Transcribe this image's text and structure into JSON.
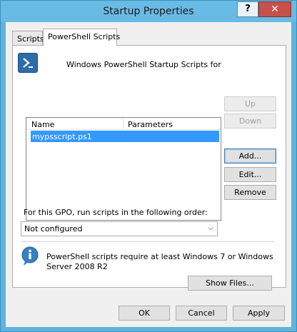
{
  "window": {
    "title": "Startup Properties",
    "help_label": "?",
    "close_label": "✕"
  },
  "tabs": [
    {
      "label": "Scripts",
      "active": false
    },
    {
      "label": "PowerShell Scripts",
      "active": true
    }
  ],
  "header": {
    "text": "Windows PowerShell Startup Scripts for",
    "icon": "powershell-icon"
  },
  "list": {
    "columns": [
      "Name",
      "Parameters"
    ],
    "rows": [
      {
        "name": "mypsscript.ps1",
        "parameters": ""
      }
    ]
  },
  "side_buttons": {
    "up": "Up",
    "down": "Down",
    "add": "Add...",
    "edit": "Edit...",
    "remove": "Remove"
  },
  "order": {
    "label": "For this GPO, run scripts in the following order:",
    "selected": "Not configured"
  },
  "info": {
    "text": "PowerShell scripts require at least Windows 7 or Windows Server 2008 R2",
    "icon": "info-icon"
  },
  "show_files_label": "Show Files...",
  "footer": {
    "ok": "OK",
    "cancel": "Cancel",
    "apply": "Apply"
  },
  "colors": {
    "title_bar": "#68bbe4",
    "close": "#c7504b",
    "selection": "#3399ff"
  }
}
